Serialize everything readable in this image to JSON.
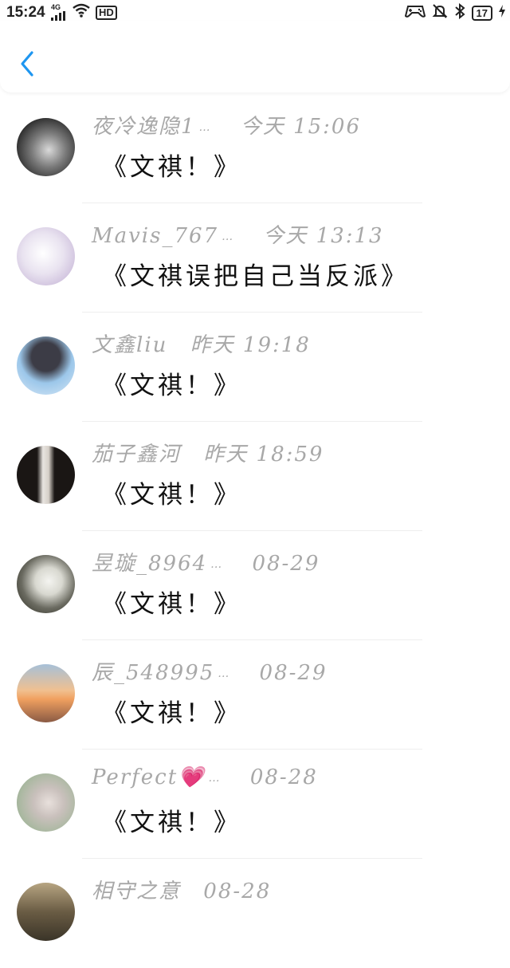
{
  "status_bar": {
    "time": "15:24",
    "network": "4G",
    "hd": "HD",
    "battery": "17"
  },
  "comments": [
    {
      "name": "夜冷逸隐1",
      "ellipsis": "…",
      "time": "今天 15:06",
      "text": "《文祺！》",
      "avatar_colors": [
        "#2b2b2b",
        "#d9d9d9"
      ]
    },
    {
      "name": "Mavis_767",
      "ellipsis": "…",
      "time": "今天 13:13",
      "text": "《文祺误把自己当反派》",
      "avatar_colors": [
        "#e9e3f0",
        "#c9b9d9"
      ]
    },
    {
      "name": "文鑫liu",
      "ellipsis": "",
      "time": "昨天 19:18",
      "text": "《文祺！》",
      "avatar_colors": [
        "#9cc7ea",
        "#3c3c46"
      ]
    },
    {
      "name": "茄子鑫河",
      "ellipsis": "",
      "time": "昨天 18:59",
      "text": "《文祺！》",
      "avatar_colors": [
        "#1a1614",
        "#8a6d5a"
      ]
    },
    {
      "name": "昱璇_8964",
      "ellipsis": "…",
      "time": "08-29",
      "text": "《文祺！》",
      "avatar_colors": [
        "#3a3a30",
        "#d8d8d0"
      ]
    },
    {
      "name": "辰_548995",
      "ellipsis": "…",
      "time": "08-29",
      "text": "《文祺！》",
      "avatar_colors": [
        "#f0a060",
        "#a6c0d8"
      ]
    },
    {
      "name": "Perfect💗",
      "ellipsis": "…",
      "time": "08-28",
      "text": "《文祺！》",
      "avatar_colors": [
        "#a9b8a0",
        "#e8e0dc"
      ]
    },
    {
      "name": "相守之意",
      "ellipsis": "",
      "time": "08-28",
      "text": "",
      "avatar_colors": [
        "#3a3428",
        "#b7a582"
      ]
    }
  ],
  "colors": {
    "accent": "#1e96f0",
    "meta_text": "#a8a8a8",
    "comment_text": "#111111"
  }
}
